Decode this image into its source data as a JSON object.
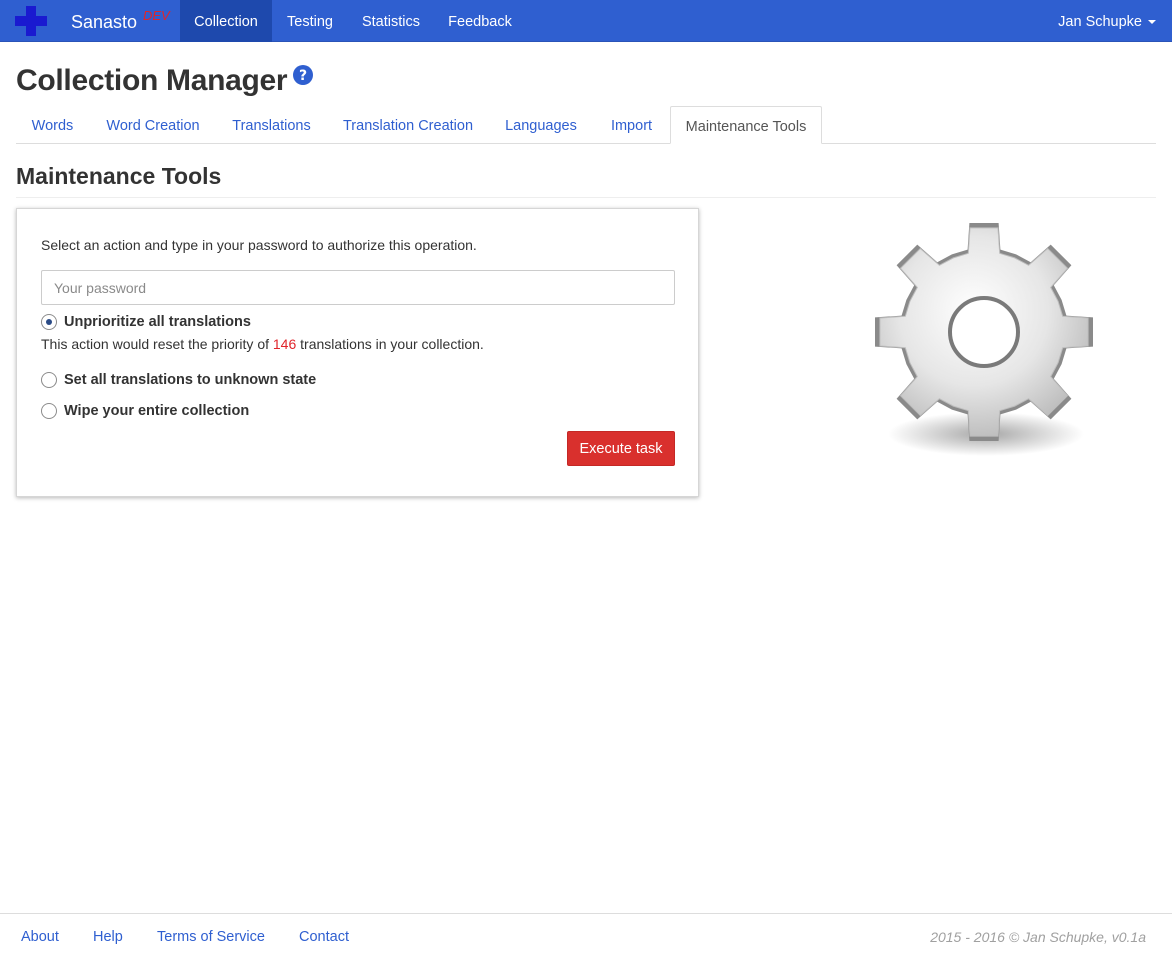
{
  "navbar": {
    "brand": "Sanasto",
    "brand_tag": "DEV",
    "items": [
      {
        "label": "Collection",
        "active": true
      },
      {
        "label": "Testing",
        "active": false
      },
      {
        "label": "Statistics",
        "active": false
      },
      {
        "label": "Feedback",
        "active": false
      }
    ],
    "user": "Jan Schupke",
    "logo_icon": "plus-cross-icon",
    "colors": {
      "bar": "#2f5fd0",
      "active": "#1e49ad",
      "logo": "#1a1ad0"
    }
  },
  "page": {
    "title": "Collection Manager",
    "help_icon": "question-circle-icon"
  },
  "tabs": [
    {
      "label": "Words",
      "active": false
    },
    {
      "label": "Word Creation",
      "active": false
    },
    {
      "label": "Translations",
      "active": false
    },
    {
      "label": "Translation Creation",
      "active": false
    },
    {
      "label": "Languages",
      "active": false
    },
    {
      "label": "Import",
      "active": false
    },
    {
      "label": "Maintenance Tools",
      "active": true
    }
  ],
  "section": {
    "title": "Maintenance Tools"
  },
  "form": {
    "intro": "Select an action and type in your password to authorize this operation.",
    "password_placeholder": "Your password",
    "password_value": "",
    "options": [
      {
        "label": "Unprioritize all translations",
        "checked": true
      },
      {
        "label": "Set all translations to unknown state",
        "checked": false
      },
      {
        "label": "Wipe your entire collection",
        "checked": false
      }
    ],
    "description_prefix": "This action would reset the priority of ",
    "description_count": "146",
    "description_suffix": " translations in your collection.",
    "execute_label": "Execute task",
    "colors": {
      "execute": "#d9302d",
      "count": "#e0252b"
    }
  },
  "illustration": {
    "icon": "gear-icon"
  },
  "footer": {
    "links": [
      "About",
      "Help",
      "Terms of Service",
      "Contact"
    ],
    "copyright": "2015 - 2016 © Jan Schupke, v0.1a"
  }
}
